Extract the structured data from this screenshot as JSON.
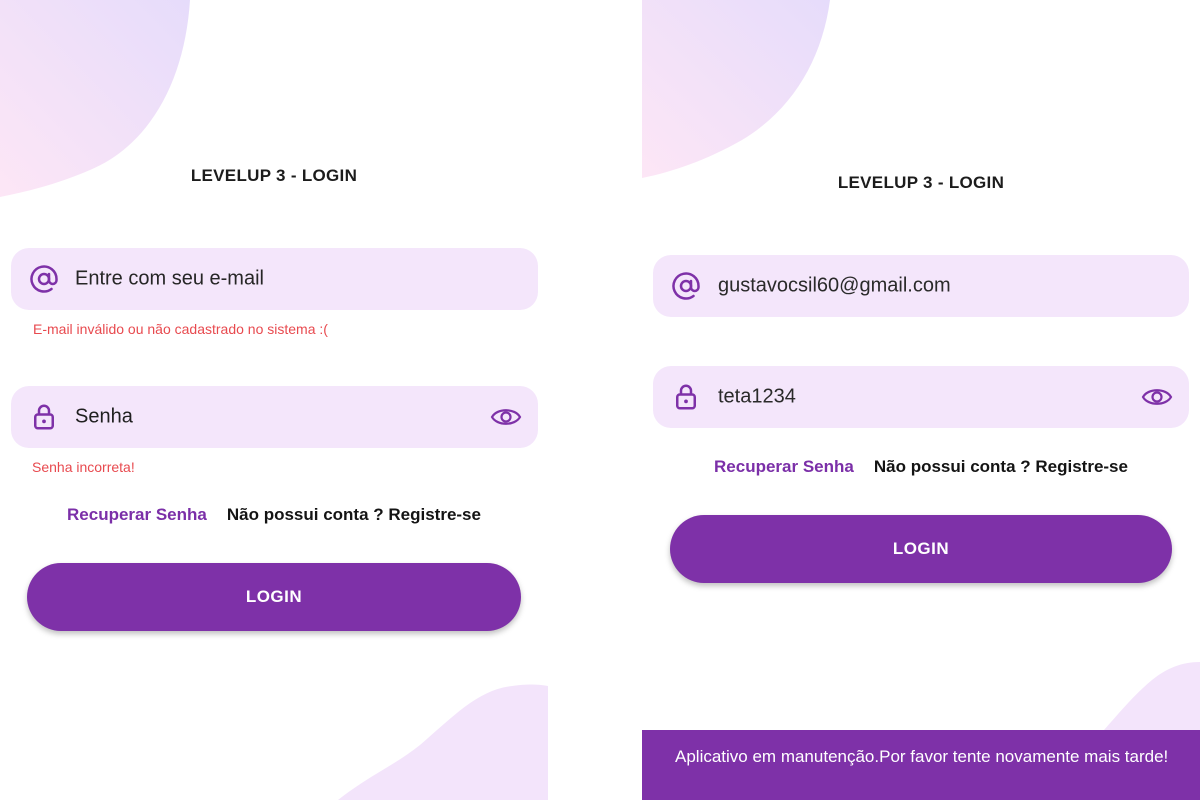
{
  "colors": {
    "primary": "#7e31a8",
    "field_bg": "#f4e6fb",
    "error": "#e84a4f",
    "blob_pink": "#fde4f7",
    "blob_lavender": "#f2e2fb"
  },
  "left_screen": {
    "title": "LEVELUP 3 - LOGIN",
    "email_field": {
      "icon": "at-sign-icon",
      "placeholder": "Entre com seu e-mail"
    },
    "email_error": "E-mail inválido ou não cadastrado no sistema :(",
    "password_field": {
      "icon": "lock-icon",
      "placeholder": "Senha",
      "toggle_icon": "eye-icon"
    },
    "password_error": "Senha incorreta!",
    "recover_link": "Recuperar Senha",
    "register_link": "Não possui conta ? Registre-se",
    "login_button": "LOGIN"
  },
  "right_screen": {
    "title": "LEVELUP 3 - LOGIN",
    "email_field": {
      "icon": "at-sign-icon",
      "value": "gustavocsil60@gmail.com"
    },
    "password_field": {
      "icon": "lock-icon",
      "value": "teta1234",
      "toggle_icon": "eye-icon"
    },
    "recover_link": "Recuperar Senha",
    "register_link": "Não possui conta ? Registre-se",
    "login_button": "LOGIN",
    "snackbar_message": "Aplicativo em manutenção.Por favor tente novamente mais tarde!"
  }
}
